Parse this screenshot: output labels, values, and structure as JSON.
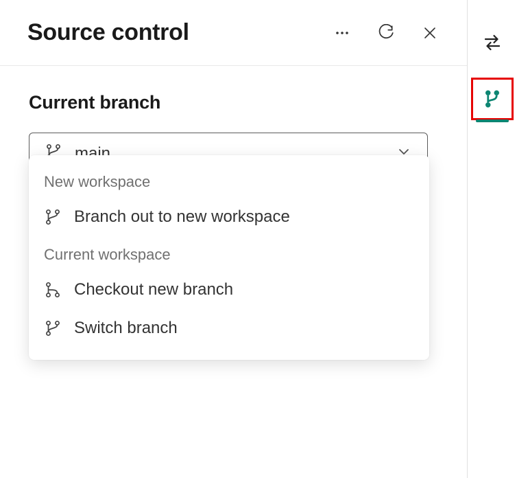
{
  "header": {
    "title": "Source control"
  },
  "section": {
    "label": "Current branch"
  },
  "dropdown": {
    "selected": "main"
  },
  "menu": {
    "section1_header": "New workspace",
    "item_branch_out": "Branch out to new workspace",
    "section2_header": "Current workspace",
    "item_checkout": "Checkout new branch",
    "item_switch": "Switch branch"
  }
}
